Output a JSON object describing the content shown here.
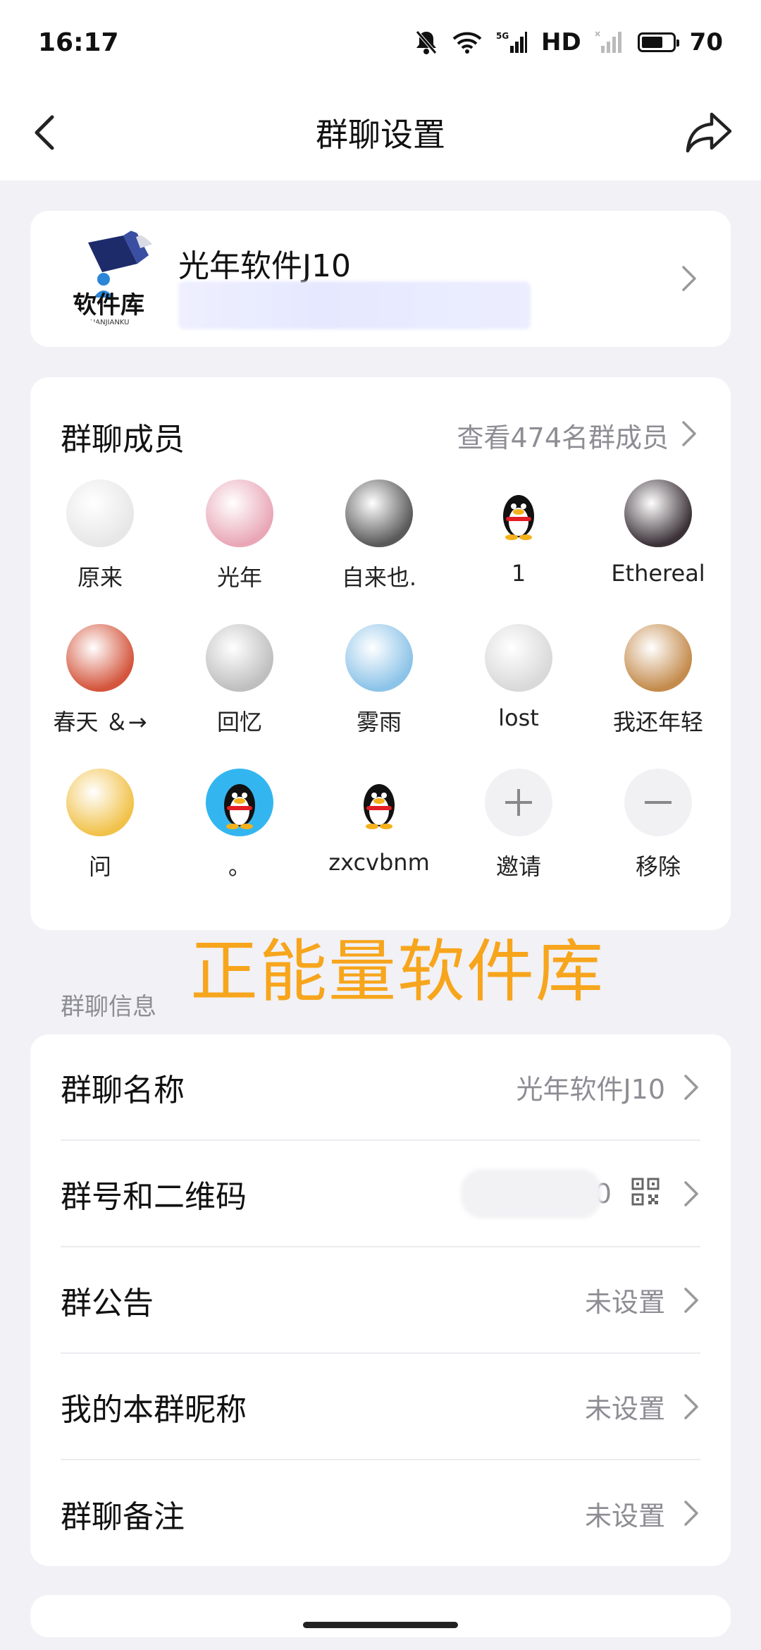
{
  "status": {
    "time": "16:17",
    "network": "5G",
    "hd": "HD",
    "battery": "70",
    "battery_level": 0.7
  },
  "nav": {
    "title": "群聊设置"
  },
  "group": {
    "name": "光年软件J10",
    "logo_text": "软件库",
    "logo_sub": "RUANJIANKU"
  },
  "members_section": {
    "title": "群聊成员",
    "view_all": "查看474名群成员",
    "members": [
      {
        "name": "原来",
        "avatar": "line-art",
        "color": "#e7e7e7"
      },
      {
        "name": "光年",
        "avatar": "pink-gradient",
        "color": "#e9a7b6"
      },
      {
        "name": "自来也.",
        "avatar": "portrait-dark",
        "color": "#5a5a5a"
      },
      {
        "name": "1",
        "avatar": "qq-penguin-icon",
        "color": "#ffffff"
      },
      {
        "name": "Ethereal",
        "avatar": "portrait-anime",
        "color": "#3b3238"
      },
      {
        "name": "春天 ＆→",
        "avatar": "portrait-red",
        "color": "#d4553c"
      },
      {
        "name": "回忆",
        "avatar": "portrait-grey",
        "color": "#bfbfbf"
      },
      {
        "name": "雾雨",
        "avatar": "anime-sky",
        "color": "#8cc3e8"
      },
      {
        "name": "lost",
        "avatar": "portrait-dog",
        "color": "#d9d9d9"
      },
      {
        "name": "我还年轻",
        "avatar": "shiba-dog",
        "color": "#c48b4c"
      },
      {
        "name": "问",
        "avatar": "pixel-art",
        "color": "#f1c24a"
      },
      {
        "name": "。",
        "avatar": "qq-penguin-blue-icon",
        "color": "#33b6f0"
      },
      {
        "name": "zxcvbnm",
        "avatar": "qq-penguin-icon",
        "color": "#ffffff"
      }
    ],
    "invite": "邀请",
    "remove": "移除"
  },
  "watermark": "正能量软件库",
  "info_section": {
    "label": "群聊信息",
    "rows": [
      {
        "label": "群聊名称",
        "value": "光年软件J10"
      },
      {
        "label": "群号和二维码",
        "value": "0"
      },
      {
        "label": "群公告",
        "value": "未设置"
      },
      {
        "label": "我的本群昵称",
        "value": "未设置"
      },
      {
        "label": "群聊备注",
        "value": "未设置"
      }
    ]
  },
  "colors": {
    "background": "#f1f1f6",
    "card": "#ffffff",
    "secondary_text": "#8d8d94",
    "watermark": "#f7a51c"
  }
}
